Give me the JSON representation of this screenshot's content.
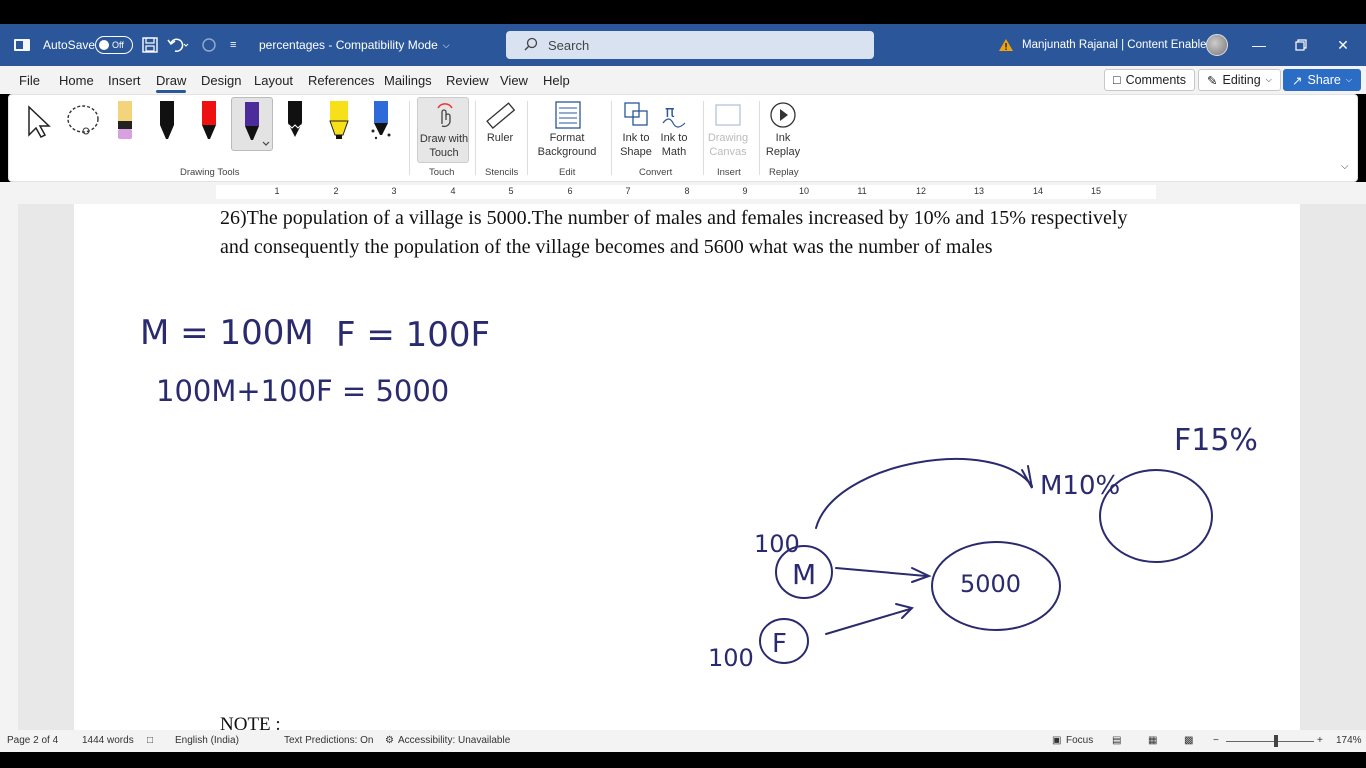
{
  "titlebar": {
    "autosave_label": "AutoSave",
    "autosave_state": "Off",
    "doc_title": "percentages  -  Compatibility Mode",
    "search_placeholder": "Search",
    "user_name": "Manjunath Rajanal | Content Enablers"
  },
  "menu": {
    "tabs": [
      "File",
      "Home",
      "Insert",
      "Draw",
      "Design",
      "Layout",
      "References",
      "Mailings",
      "Review",
      "View",
      "Help"
    ],
    "active_tab": "Draw",
    "comments_label": "Comments",
    "editing_label": "Editing",
    "share_label": "Share"
  },
  "ribbon": {
    "groups": {
      "drawing_tools": "Drawing Tools",
      "touch": "Touch",
      "stencils": "Stencils",
      "edit": "Edit",
      "convert": "Convert",
      "insert": "Insert",
      "replay": "Replay"
    },
    "buttons": {
      "draw_with_touch": "Draw with Touch",
      "ruler": "Ruler",
      "format_background": "Format Background",
      "ink_to_shape": "Ink to Shape",
      "ink_to_math": "Ink to Math",
      "drawing_canvas": "Drawing Canvas",
      "ink_replay": "Ink Replay"
    }
  },
  "ruler": {
    "ticks": [
      "1",
      "2",
      "3",
      "4",
      "5",
      "6",
      "7",
      "8",
      "9",
      "10",
      "11",
      "12",
      "13",
      "14",
      "15"
    ]
  },
  "document": {
    "question": "26)The population of a village is 5000.The number of males and females increased by 10% and 15% respectively and consequently the population of the village becomes and 5600 what was the number of males",
    "note": "NOTE :",
    "ink": {
      "line1a": "M = 100M",
      "line1b": "F = 100F",
      "line2": "100M+100F = 5000",
      "m_label": "M",
      "f_label": "F",
      "hundred_m": "100",
      "hundred_f": "100",
      "total": "5000",
      "m_pct": "M10%",
      "f_pct": "F15%"
    }
  },
  "status": {
    "page": "Page 2 of 4",
    "words": "1444 words",
    "language": "English (India)",
    "text_predictions": "Text Predictions: On",
    "accessibility": "Accessibility: Unavailable",
    "focus": "Focus",
    "zoom": "174%"
  },
  "colors": {
    "brand": "#2b579a",
    "ink": "#2a2a6e"
  }
}
